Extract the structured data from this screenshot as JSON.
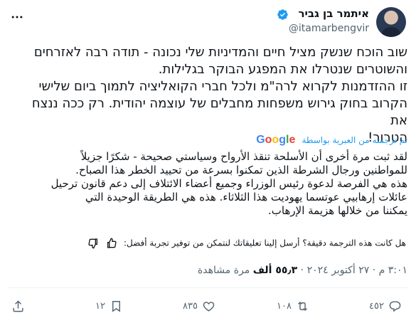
{
  "user": {
    "name": "איתמר בן גביר",
    "handle": "@itamarbengvir"
  },
  "tweet": {
    "lines": [
      "שוב הוכח שנשק מציל חיים והמדיניות שלי נכונה - תודה רבה לאזרחים",
      "והשוטרים שנטרלו את המפגע הבוקר בגלילות.",
      "זו ההזדמנות לקרוא לרה\"מ ולכל חברי הקואליציה לתמוך ביום שלישי",
      "הקרוב בחוק גירוש משפחות מחבלים של עוצמה יהודית. רק ככה ננצח את",
      "הטרור!"
    ]
  },
  "translate": {
    "label": "تم ترجمته من العبرية بواسطة",
    "provider": "Google"
  },
  "translation": {
    "lines": [
      "لقد ثبت مرة أخرى أن الأسلحة تنقذ الأرواح وسياستي صحيحة - شكرًا جزيلاً",
      "للمواطنين ورجال الشرطة الذين تمكنوا بسرعة من تحييد الخطر هذا الصباح.",
      "هذه هي الفرصة لدعوة رئيس الوزراء وجميع أعضاء الائتلاف إلى دعم قانون ترحيل",
      "عائلات إرهابيي عوتسما يهوديت هذا الثلاثاء. هذه هي الطريقة الوحيدة التي",
      "يمكننا من خلالها هزيمة الإرهاب."
    ]
  },
  "feedback": {
    "text": "هل كانت هذه الترجمة دقيقة؟ أرسل إلينا تعليقاتك لنتمكن من توفير تجربة أفضل:"
  },
  "meta": {
    "time": "٣:٠١ م",
    "separator": "·",
    "date": "٢٧ أكتوبر ٢٠٢٤",
    "views_count": "٥٥٫٣ ألف",
    "views_label": "مرة مشاهدة"
  },
  "actions": {
    "replies": "١٢",
    "retweets": "١٠٨",
    "likes": "٨٣٥",
    "bookmarks": "٤٥٢"
  },
  "colors": {
    "accent": "#1d9bf0",
    "secondary_text": "#536471",
    "primary_text": "#0f1419"
  },
  "icons": [
    "verified-badge-icon",
    "more-icon",
    "thumbs-up-icon",
    "thumbs-down-icon",
    "reply-icon",
    "retweet-icon",
    "like-icon",
    "bookmark-icon",
    "share-icon"
  ]
}
